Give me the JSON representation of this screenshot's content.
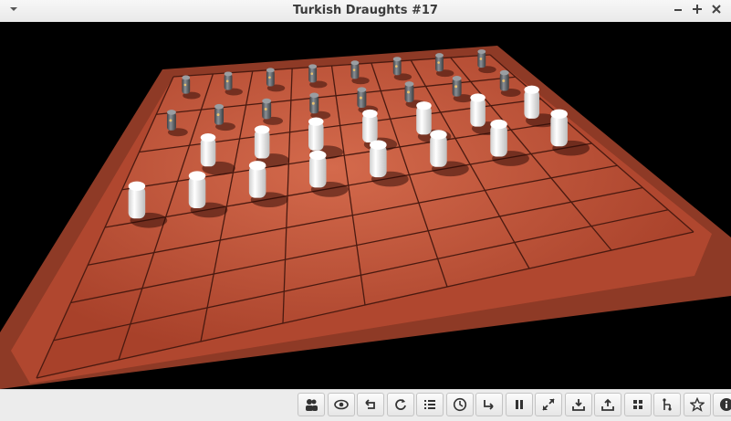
{
  "window": {
    "title": "Turkish Draughts #17"
  },
  "titlebar_icons": [
    "menu-down-icon",
    "minimize-icon",
    "maximize-icon",
    "close-icon"
  ],
  "game": {
    "board_size": 8,
    "colors": {
      "board": "#b24a32",
      "frame": "#9c3a22",
      "white_piece": "#f2f2f2",
      "black_piece": "#5a5e63"
    },
    "black_pieces": 16,
    "white_pieces": 15
  },
  "toolbar": [
    {
      "name": "players-button",
      "icon": "players-icon"
    },
    {
      "name": "view-button",
      "icon": "eye-icon"
    },
    {
      "name": "undo-button",
      "icon": "undo-icon"
    },
    {
      "name": "restart-button",
      "icon": "restart-icon"
    },
    {
      "name": "moves-list-button",
      "icon": "list-icon"
    },
    {
      "name": "clock-button",
      "icon": "clock-icon"
    },
    {
      "name": "redo-button",
      "icon": "redo-icon"
    },
    {
      "name": "pause-button",
      "icon": "pause-icon"
    },
    {
      "name": "fullscreen-button",
      "icon": "fullscreen-icon"
    },
    {
      "name": "download-button",
      "icon": "download-icon"
    },
    {
      "name": "upload-button",
      "icon": "upload-icon"
    },
    {
      "name": "grid-button",
      "icon": "grid-icon"
    },
    {
      "name": "analysis-button",
      "icon": "tree-icon"
    },
    {
      "name": "favorite-button",
      "icon": "star-icon"
    },
    {
      "name": "info-button",
      "icon": "info-icon"
    }
  ]
}
